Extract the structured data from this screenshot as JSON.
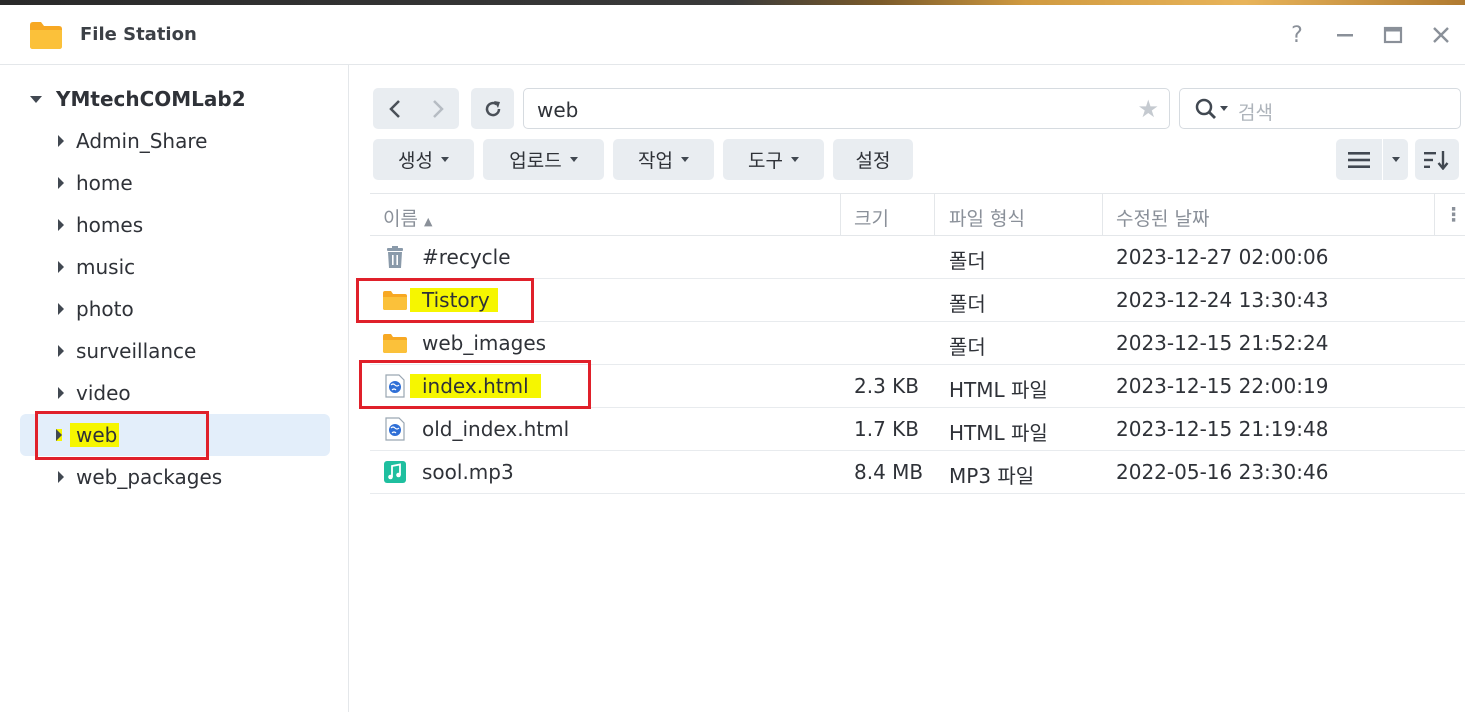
{
  "window": {
    "title": "File Station",
    "controls": {
      "help": "?",
      "minimize": "—",
      "maximize": "▭",
      "close": "✕"
    }
  },
  "sidebar": {
    "root": "YMtechCOMLab2",
    "items": [
      {
        "label": "Admin_Share"
      },
      {
        "label": "home"
      },
      {
        "label": "homes"
      },
      {
        "label": "music"
      },
      {
        "label": "photo"
      },
      {
        "label": "surveillance"
      },
      {
        "label": "video"
      },
      {
        "label": "web",
        "selected": true
      },
      {
        "label": "web_packages"
      }
    ]
  },
  "toolbar": {
    "path": "web",
    "search_placeholder": "검색",
    "buttons": {
      "create": "생성",
      "upload": "업로드",
      "action": "작업",
      "tools": "도구",
      "settings": "설정"
    }
  },
  "table": {
    "headers": {
      "name": "이름",
      "size": "크기",
      "type": "파일 형식",
      "modified": "수정된 날짜"
    },
    "rows": [
      {
        "icon": "recycle-bin-icon",
        "name": "#recycle",
        "size": "",
        "type": "폴더",
        "modified": "2023-12-27 02:00:06"
      },
      {
        "icon": "folder-icon",
        "name": "Tistory",
        "size": "",
        "type": "폴더",
        "modified": "2023-12-24 13:30:43"
      },
      {
        "icon": "folder-icon",
        "name": "web_images",
        "size": "",
        "type": "폴더",
        "modified": "2023-12-15 21:52:24"
      },
      {
        "icon": "html-file-icon",
        "name": "index.html",
        "size": "2.3 KB",
        "type": "HTML 파일",
        "modified": "2023-12-15 22:00:19"
      },
      {
        "icon": "html-file-icon",
        "name": "old_index.html",
        "size": "1.7 KB",
        "type": "HTML 파일",
        "modified": "2023-12-15 21:19:48"
      },
      {
        "icon": "music-file-icon",
        "name": "sool.mp3",
        "size": "8.4 MB",
        "type": "MP3 파일",
        "modified": "2022-05-16 23:30:46"
      }
    ]
  },
  "colors": {
    "accent_selected": "#e3eefa",
    "highlight": "#f6f600",
    "annotation_red": "#e0202a",
    "folder_yellow": "#f7b731",
    "music_green": "#1fbf9f",
    "html_blue": "#2f6fd6"
  }
}
